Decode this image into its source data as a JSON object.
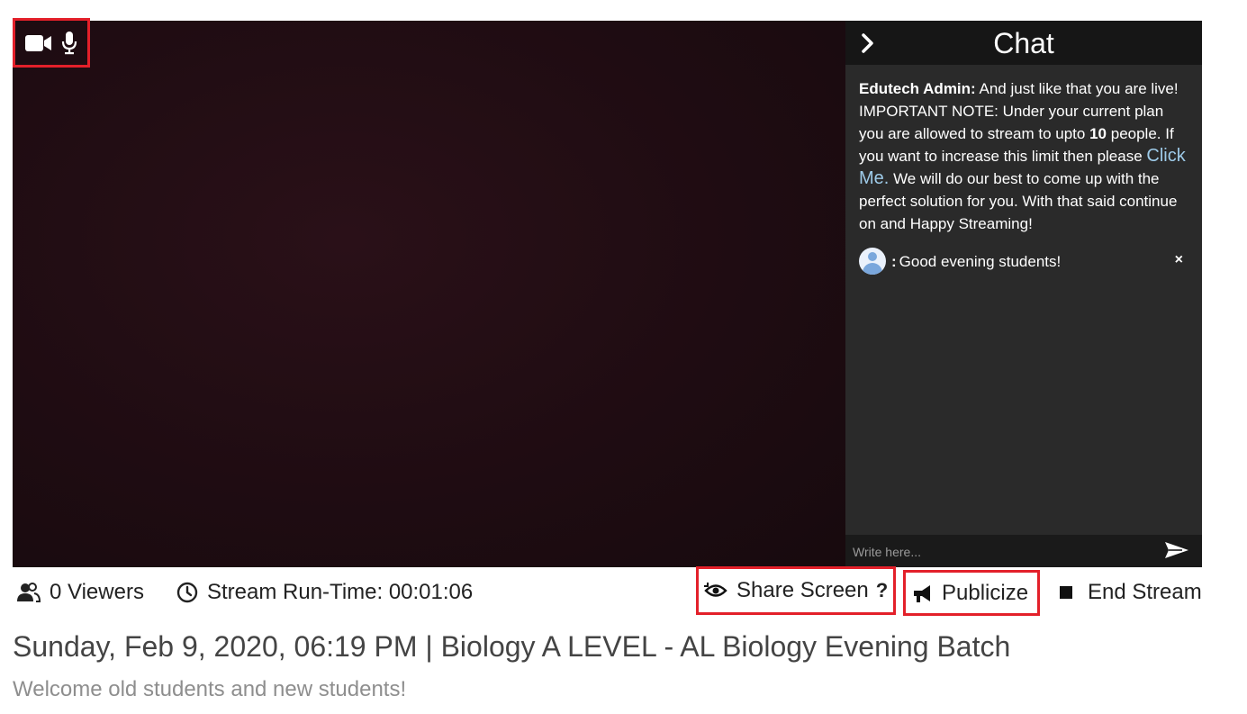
{
  "media": {
    "camera_icon": "video-camera-icon",
    "mic_icon": "microphone-icon"
  },
  "chat": {
    "title": "Chat",
    "toggle_icon": "chevron-right-icon",
    "admin_message": {
      "sender": "Edutech Admin:",
      "text_before_limit": " And just like that you are live! IMPORTANT NOTE: Under your current plan you are allowed to stream to upto ",
      "limit": "10",
      "text_after_limit": " people. If you want to increase this limit then please ",
      "link_text": "Click Me.",
      "text_after_link": " We will do our best to come up with the perfect solution for you. With that said continue on and Happy Streaming!"
    },
    "messages": [
      {
        "sender": "",
        "separator": ":",
        "text": "Good evening students!",
        "delete_label": "×"
      }
    ],
    "input_placeholder": "Write here...",
    "send_icon": "send-icon"
  },
  "toolbar": {
    "viewers": "0 Viewers",
    "runtime_label": "Stream Run-Time: 00:01:06",
    "share_screen": "Share Screen",
    "share_help": "?",
    "publicize": "Publicize",
    "end_stream": "End Stream"
  },
  "stream": {
    "title": "Sunday, Feb 9, 2020, 06:19 PM | Biology A LEVEL - AL Biology Evening Batch",
    "description": "Welcome old students and new students!"
  },
  "colors": {
    "highlight": "#e3202a",
    "chat_bg": "#2a2a2a",
    "chat_header_bg": "#161616",
    "link": "#9ecbe9"
  }
}
